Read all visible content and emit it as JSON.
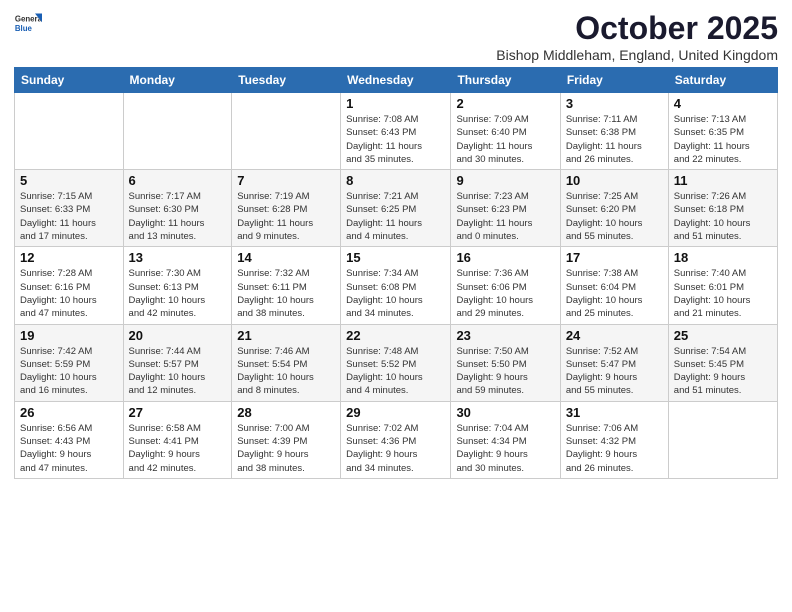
{
  "header": {
    "logo_line1": "General",
    "logo_line2": "Blue",
    "main_title": "October 2025",
    "subtitle": "Bishop Middleham, England, United Kingdom"
  },
  "days_of_week": [
    "Sunday",
    "Monday",
    "Tuesday",
    "Wednesday",
    "Thursday",
    "Friday",
    "Saturday"
  ],
  "weeks": [
    [
      {
        "num": "",
        "info": ""
      },
      {
        "num": "",
        "info": ""
      },
      {
        "num": "",
        "info": ""
      },
      {
        "num": "1",
        "info": "Sunrise: 7:08 AM\nSunset: 6:43 PM\nDaylight: 11 hours\nand 35 minutes."
      },
      {
        "num": "2",
        "info": "Sunrise: 7:09 AM\nSunset: 6:40 PM\nDaylight: 11 hours\nand 30 minutes."
      },
      {
        "num": "3",
        "info": "Sunrise: 7:11 AM\nSunset: 6:38 PM\nDaylight: 11 hours\nand 26 minutes."
      },
      {
        "num": "4",
        "info": "Sunrise: 7:13 AM\nSunset: 6:35 PM\nDaylight: 11 hours\nand 22 minutes."
      }
    ],
    [
      {
        "num": "5",
        "info": "Sunrise: 7:15 AM\nSunset: 6:33 PM\nDaylight: 11 hours\nand 17 minutes."
      },
      {
        "num": "6",
        "info": "Sunrise: 7:17 AM\nSunset: 6:30 PM\nDaylight: 11 hours\nand 13 minutes."
      },
      {
        "num": "7",
        "info": "Sunrise: 7:19 AM\nSunset: 6:28 PM\nDaylight: 11 hours\nand 9 minutes."
      },
      {
        "num": "8",
        "info": "Sunrise: 7:21 AM\nSunset: 6:25 PM\nDaylight: 11 hours\nand 4 minutes."
      },
      {
        "num": "9",
        "info": "Sunrise: 7:23 AM\nSunset: 6:23 PM\nDaylight: 11 hours\nand 0 minutes."
      },
      {
        "num": "10",
        "info": "Sunrise: 7:25 AM\nSunset: 6:20 PM\nDaylight: 10 hours\nand 55 minutes."
      },
      {
        "num": "11",
        "info": "Sunrise: 7:26 AM\nSunset: 6:18 PM\nDaylight: 10 hours\nand 51 minutes."
      }
    ],
    [
      {
        "num": "12",
        "info": "Sunrise: 7:28 AM\nSunset: 6:16 PM\nDaylight: 10 hours\nand 47 minutes."
      },
      {
        "num": "13",
        "info": "Sunrise: 7:30 AM\nSunset: 6:13 PM\nDaylight: 10 hours\nand 42 minutes."
      },
      {
        "num": "14",
        "info": "Sunrise: 7:32 AM\nSunset: 6:11 PM\nDaylight: 10 hours\nand 38 minutes."
      },
      {
        "num": "15",
        "info": "Sunrise: 7:34 AM\nSunset: 6:08 PM\nDaylight: 10 hours\nand 34 minutes."
      },
      {
        "num": "16",
        "info": "Sunrise: 7:36 AM\nSunset: 6:06 PM\nDaylight: 10 hours\nand 29 minutes."
      },
      {
        "num": "17",
        "info": "Sunrise: 7:38 AM\nSunset: 6:04 PM\nDaylight: 10 hours\nand 25 minutes."
      },
      {
        "num": "18",
        "info": "Sunrise: 7:40 AM\nSunset: 6:01 PM\nDaylight: 10 hours\nand 21 minutes."
      }
    ],
    [
      {
        "num": "19",
        "info": "Sunrise: 7:42 AM\nSunset: 5:59 PM\nDaylight: 10 hours\nand 16 minutes."
      },
      {
        "num": "20",
        "info": "Sunrise: 7:44 AM\nSunset: 5:57 PM\nDaylight: 10 hours\nand 12 minutes."
      },
      {
        "num": "21",
        "info": "Sunrise: 7:46 AM\nSunset: 5:54 PM\nDaylight: 10 hours\nand 8 minutes."
      },
      {
        "num": "22",
        "info": "Sunrise: 7:48 AM\nSunset: 5:52 PM\nDaylight: 10 hours\nand 4 minutes."
      },
      {
        "num": "23",
        "info": "Sunrise: 7:50 AM\nSunset: 5:50 PM\nDaylight: 9 hours\nand 59 minutes."
      },
      {
        "num": "24",
        "info": "Sunrise: 7:52 AM\nSunset: 5:47 PM\nDaylight: 9 hours\nand 55 minutes."
      },
      {
        "num": "25",
        "info": "Sunrise: 7:54 AM\nSunset: 5:45 PM\nDaylight: 9 hours\nand 51 minutes."
      }
    ],
    [
      {
        "num": "26",
        "info": "Sunrise: 6:56 AM\nSunset: 4:43 PM\nDaylight: 9 hours\nand 47 minutes."
      },
      {
        "num": "27",
        "info": "Sunrise: 6:58 AM\nSunset: 4:41 PM\nDaylight: 9 hours\nand 42 minutes."
      },
      {
        "num": "28",
        "info": "Sunrise: 7:00 AM\nSunset: 4:39 PM\nDaylight: 9 hours\nand 38 minutes."
      },
      {
        "num": "29",
        "info": "Sunrise: 7:02 AM\nSunset: 4:36 PM\nDaylight: 9 hours\nand 34 minutes."
      },
      {
        "num": "30",
        "info": "Sunrise: 7:04 AM\nSunset: 4:34 PM\nDaylight: 9 hours\nand 30 minutes."
      },
      {
        "num": "31",
        "info": "Sunrise: 7:06 AM\nSunset: 4:32 PM\nDaylight: 9 hours\nand 26 minutes."
      },
      {
        "num": "",
        "info": ""
      }
    ]
  ]
}
